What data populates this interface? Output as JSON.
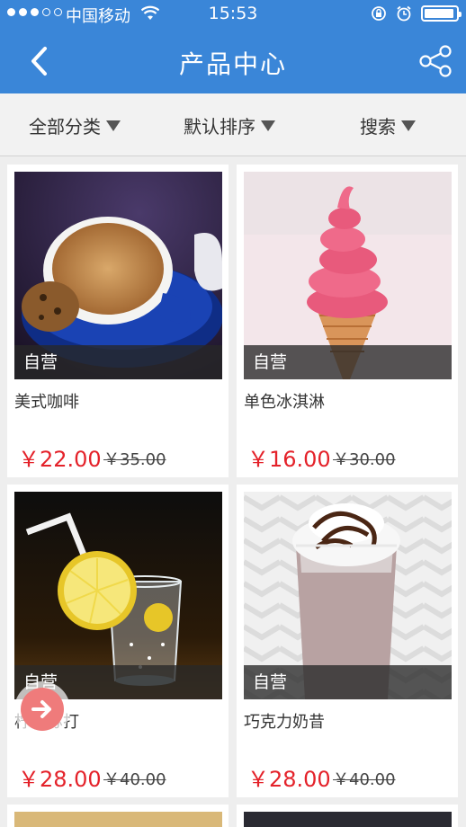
{
  "status_bar": {
    "carrier": "中国移动",
    "time": "15:53",
    "icons": [
      "signal-dots-icon",
      "wifi-icon",
      "rotation-lock-icon",
      "alarm-icon",
      "battery-icon"
    ]
  },
  "nav": {
    "title": "产品中心",
    "back_icon": "chevron-left-icon",
    "share_icon": "share-icon"
  },
  "filters": [
    {
      "label": "全部分类"
    },
    {
      "label": "默认排序"
    },
    {
      "label": "搜索"
    }
  ],
  "products": [
    {
      "badge": "自营",
      "name": "美式咖啡",
      "price": "￥22.00",
      "original_price": "￥35.00"
    },
    {
      "badge": "自营",
      "name": "单色冰淇淋",
      "price": "￥16.00",
      "original_price": "￥30.00"
    },
    {
      "badge": "自营",
      "name": "柠檬苏打",
      "price": "￥28.00",
      "original_price": "￥40.00"
    },
    {
      "badge": "自营",
      "name": "巧克力奶昔",
      "price": "￥28.00",
      "original_price": "￥40.00"
    }
  ],
  "colors": {
    "header": "#3a86d8",
    "price": "#e4222a",
    "fab": "#ef7b7b"
  },
  "floating_button_icon": "arrow-right-icon"
}
